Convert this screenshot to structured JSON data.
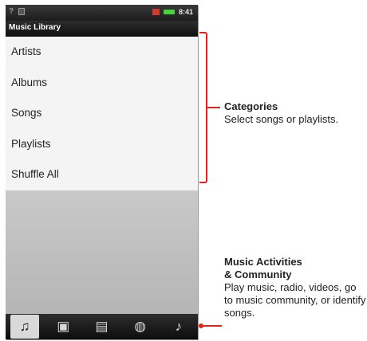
{
  "statusbar": {
    "left_icons": [
      "question-icon",
      "notification-icon"
    ],
    "time": "8:41"
  },
  "app": {
    "title": "Music Library"
  },
  "list": {
    "items": [
      "Artists",
      "Albums",
      "Songs",
      "Playlists",
      "Shuffle All"
    ]
  },
  "tabs": [
    {
      "icon": "music-note-icon",
      "glyph": "♫",
      "active": true
    },
    {
      "icon": "radio-icon",
      "glyph": "📻",
      "active": false
    },
    {
      "icon": "video-icon",
      "glyph": "🎞",
      "active": false
    },
    {
      "icon": "community-globe-icon",
      "glyph": "🌐",
      "active": false
    },
    {
      "icon": "identify-song-icon",
      "glyph": "🎤",
      "active": false
    }
  ],
  "callouts": {
    "categories": {
      "title": "Categories",
      "text": "Select songs or playlists."
    },
    "activities": {
      "title_line1": "Music Activities",
      "title_line2": "& Community",
      "text": "Play music, radio, videos, go to music community, or identify songs."
    }
  },
  "colors": {
    "callout": "#e0231b",
    "active_tab": "#d9d9d9"
  }
}
